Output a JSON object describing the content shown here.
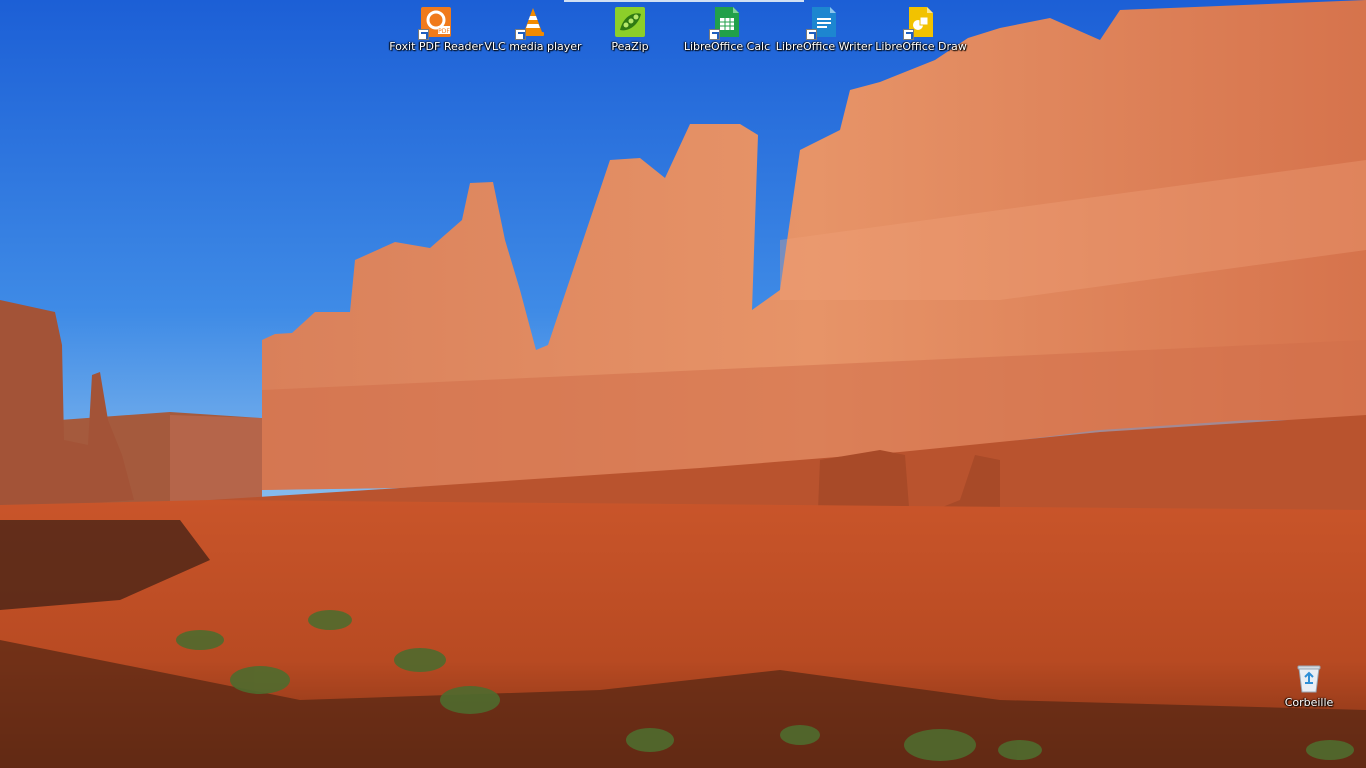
{
  "desktop": {
    "wallpaper": "red-rock-canyon",
    "icons": [
      {
        "label": "Foxit PDF Reader",
        "icon": "foxit-pdf-icon",
        "color": "#f07a1b"
      },
      {
        "label": "VLC media player",
        "icon": "vlc-cone-icon",
        "color": "#f28a00"
      },
      {
        "label": "PeaZip",
        "icon": "peazip-icon",
        "color": "#8ccf2a"
      },
      {
        "label": "LibreOffice Calc",
        "icon": "libreoffice-calc-icon",
        "color": "#21a04a"
      },
      {
        "label": "LibreOffice Writer",
        "icon": "libreoffice-writer-icon",
        "color": "#1d86d0"
      },
      {
        "label": "LibreOffice Draw",
        "icon": "libreoffice-draw-icon",
        "color": "#f2c200"
      },
      {
        "label": "Corbeille",
        "icon": "recycle-bin-icon",
        "color": "#e9eef4"
      }
    ]
  }
}
